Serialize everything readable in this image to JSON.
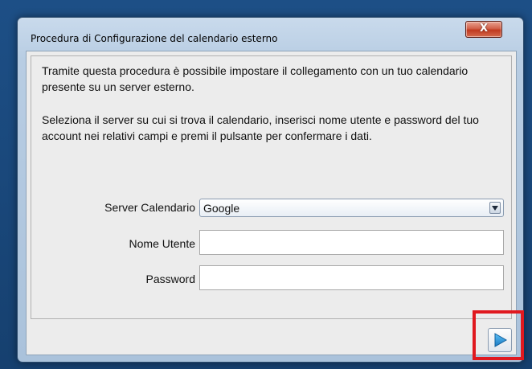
{
  "window": {
    "title": "Procedura di Configurazione del calendario esterno",
    "close_label": "X"
  },
  "content": {
    "paragraph1": "Tramite questa procedura è possibile impostare il collegamento con un tuo calendario presente su un server esterno.",
    "paragraph2": "Seleziona il server su cui si trova il calendario, inserisci nome utente e password del tuo account nei relativi campi e premi il pulsante per confermare i dati."
  },
  "form": {
    "server_label": "Server Calendario",
    "server_value": "Google",
    "username_label": "Nome Utente",
    "username_value": "",
    "password_label": "Password",
    "password_value": ""
  },
  "footer": {
    "next_icon": "play-arrow-icon"
  },
  "colors": {
    "highlight": "#e0191f",
    "next_arrow": "#1f8fd6"
  }
}
